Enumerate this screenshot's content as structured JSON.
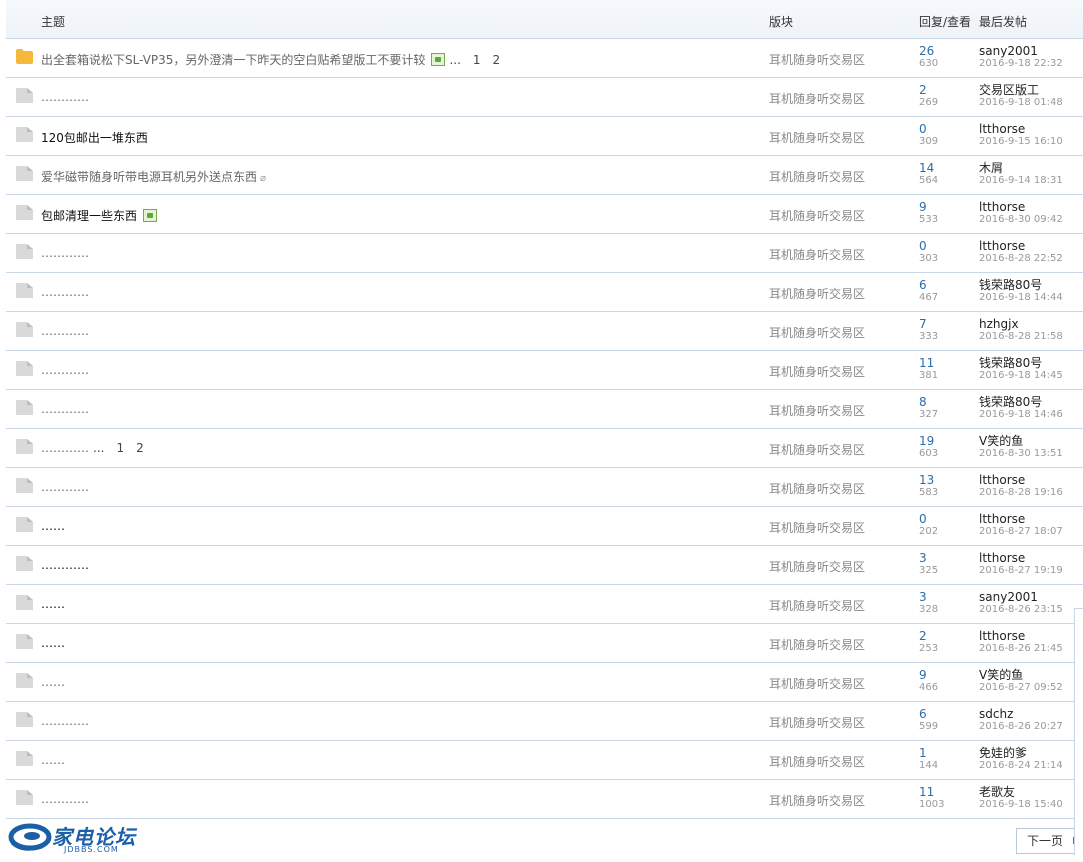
{
  "header": {
    "topic": "主题",
    "forum": "版块",
    "reply_view": "回复/查看",
    "last_post": "最后发帖"
  },
  "rows": [
    {
      "icon": "folder",
      "title": "出全套箱说松下SL-VP35，另外澄清一下昨天的空白贴希望版工不要计较",
      "title_style": "gray",
      "has_image": true,
      "pages": [
        "1",
        "2"
      ],
      "forum": "耳机随身听交易区",
      "replies": "26",
      "views": "630",
      "author": "sany2001",
      "date": "2016-9-18 22:32"
    },
    {
      "icon": "file",
      "title": "…………",
      "title_style": "gray",
      "forum": "耳机随身听交易区",
      "replies": "2",
      "views": "269",
      "author": "交易区版工",
      "date": "2016-9-18 01:48"
    },
    {
      "icon": "file",
      "title": "120包邮出一堆东西",
      "title_style": "dark",
      "forum": "耳机随身听交易区",
      "replies": "0",
      "views": "309",
      "author": "ltthorse",
      "date": "2016-9-15 16:10"
    },
    {
      "icon": "file",
      "title": "爱华磁带随身听带电源耳机另外送点东西",
      "title_style": "gray",
      "has_clip": true,
      "forum": "耳机随身听交易区",
      "replies": "14",
      "views": "564",
      "author": "木屑",
      "date": "2016-9-14 18:31"
    },
    {
      "icon": "file",
      "title": "包邮清理一些东西",
      "title_style": "dark",
      "has_image": true,
      "forum": "耳机随身听交易区",
      "replies": "9",
      "views": "533",
      "author": "ltthorse",
      "date": "2016-8-30 09:42"
    },
    {
      "icon": "file",
      "title": "…………",
      "title_style": "gray",
      "forum": "耳机随身听交易区",
      "replies": "0",
      "views": "303",
      "author": "ltthorse",
      "date": "2016-8-28 22:52"
    },
    {
      "icon": "file",
      "title": "…………",
      "title_style": "gray",
      "forum": "耳机随身听交易区",
      "replies": "6",
      "views": "467",
      "author": "钱荣路80号",
      "date": "2016-9-18 14:44"
    },
    {
      "icon": "file",
      "title": "…………",
      "title_style": "gray",
      "forum": "耳机随身听交易区",
      "replies": "7",
      "views": "333",
      "author": "hzhgjx",
      "date": "2016-8-28 21:58"
    },
    {
      "icon": "file",
      "title": "…………",
      "title_style": "gray",
      "forum": "耳机随身听交易区",
      "replies": "11",
      "views": "381",
      "author": "钱荣路80号",
      "date": "2016-9-18 14:45"
    },
    {
      "icon": "file",
      "title": "…………",
      "title_style": "gray",
      "forum": "耳机随身听交易区",
      "replies": "8",
      "views": "327",
      "author": "钱荣路80号",
      "date": "2016-9-18 14:46"
    },
    {
      "icon": "file",
      "title": "…………",
      "title_style": "gray",
      "pages": [
        "1",
        "2"
      ],
      "forum": "耳机随身听交易区",
      "replies": "19",
      "views": "603",
      "author": "V笑的鱼",
      "date": "2016-8-30 13:51"
    },
    {
      "icon": "file",
      "title": "…………",
      "title_style": "gray",
      "forum": "耳机随身听交易区",
      "replies": "13",
      "views": "583",
      "author": "ltthorse",
      "date": "2016-8-28 19:16"
    },
    {
      "icon": "file",
      "title": "……",
      "title_style": "dark",
      "forum": "耳机随身听交易区",
      "replies": "0",
      "views": "202",
      "author": "ltthorse",
      "date": "2016-8-27 18:07"
    },
    {
      "icon": "file",
      "title": "…………",
      "title_style": "dark",
      "forum": "耳机随身听交易区",
      "replies": "3",
      "views": "325",
      "author": "ltthorse",
      "date": "2016-8-27 19:19"
    },
    {
      "icon": "file",
      "title": "……",
      "title_style": "dark",
      "forum": "耳机随身听交易区",
      "replies": "3",
      "views": "328",
      "author": "sany2001",
      "date": "2016-8-26 23:15"
    },
    {
      "icon": "file",
      "title": "……",
      "title_style": "dark",
      "forum": "耳机随身听交易区",
      "replies": "2",
      "views": "253",
      "author": "ltthorse",
      "date": "2016-8-26 21:45"
    },
    {
      "icon": "file",
      "title": "……",
      "title_style": "gray",
      "forum": "耳机随身听交易区",
      "replies": "9",
      "views": "466",
      "author": "V笑的鱼",
      "date": "2016-8-27 09:52"
    },
    {
      "icon": "file",
      "title": "…………",
      "title_style": "gray",
      "forum": "耳机随身听交易区",
      "replies": "6",
      "views": "599",
      "author": "sdchz",
      "date": "2016-8-26 20:27"
    },
    {
      "icon": "file",
      "title": "……",
      "title_style": "gray",
      "forum": "耳机随身听交易区",
      "replies": "1",
      "views": "144",
      "author": "免娃的爹",
      "date": "2016-8-24 21:14"
    },
    {
      "icon": "file",
      "title": "…………",
      "title_style": "gray",
      "forum": "耳机随身听交易区",
      "replies": "11",
      "views": "1003",
      "author": "老歌友",
      "date": "2016-9-18 15:40"
    }
  ],
  "pages_ellipsis": "...",
  "logo": {
    "name": "家电论坛",
    "domain": "JDBBS.COM"
  },
  "next_page": "下一页",
  "colors": {
    "link_blue": "#2b6cab",
    "folder": "#f5b83d",
    "border": "#c8d6e6"
  }
}
